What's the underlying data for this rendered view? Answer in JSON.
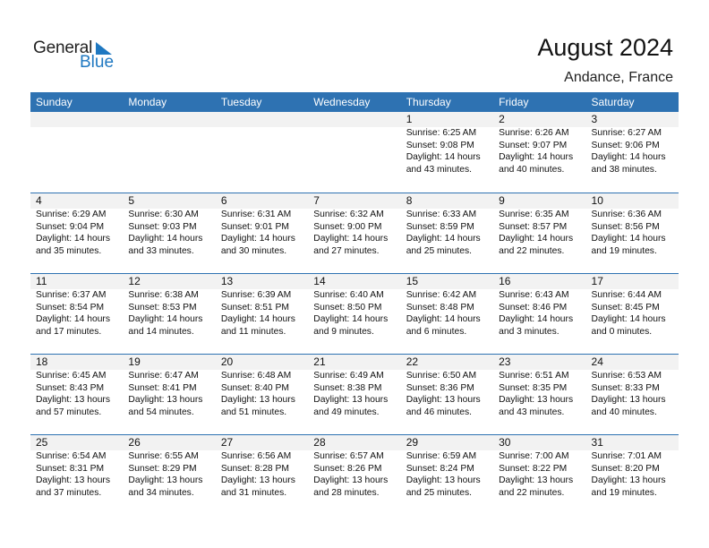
{
  "logo": {
    "line1": "General",
    "line2": "Blue"
  },
  "title": "August 2024",
  "location": "Andance, France",
  "colors": {
    "header_bg": "#2e72b2",
    "day_bar": "#f2f2f2",
    "logo_blue": "#1f78c1"
  },
  "weekdays": [
    "Sunday",
    "Monday",
    "Tuesday",
    "Wednesday",
    "Thursday",
    "Friday",
    "Saturday"
  ],
  "weeks": [
    [
      {
        "day": "",
        "sunrise": "",
        "sunset": "",
        "daylight": "",
        "minutes": ""
      },
      {
        "day": "",
        "sunrise": "",
        "sunset": "",
        "daylight": "",
        "minutes": ""
      },
      {
        "day": "",
        "sunrise": "",
        "sunset": "",
        "daylight": "",
        "minutes": ""
      },
      {
        "day": "",
        "sunrise": "",
        "sunset": "",
        "daylight": "",
        "minutes": ""
      },
      {
        "day": "1",
        "sunrise": "Sunrise: 6:25 AM",
        "sunset": "Sunset: 9:08 PM",
        "daylight": "Daylight: 14 hours",
        "minutes": "and 43 minutes."
      },
      {
        "day": "2",
        "sunrise": "Sunrise: 6:26 AM",
        "sunset": "Sunset: 9:07 PM",
        "daylight": "Daylight: 14 hours",
        "minutes": "and 40 minutes."
      },
      {
        "day": "3",
        "sunrise": "Sunrise: 6:27 AM",
        "sunset": "Sunset: 9:06 PM",
        "daylight": "Daylight: 14 hours",
        "minutes": "and 38 minutes."
      }
    ],
    [
      {
        "day": "4",
        "sunrise": "Sunrise: 6:29 AM",
        "sunset": "Sunset: 9:04 PM",
        "daylight": "Daylight: 14 hours",
        "minutes": "and 35 minutes."
      },
      {
        "day": "5",
        "sunrise": "Sunrise: 6:30 AM",
        "sunset": "Sunset: 9:03 PM",
        "daylight": "Daylight: 14 hours",
        "minutes": "and 33 minutes."
      },
      {
        "day": "6",
        "sunrise": "Sunrise: 6:31 AM",
        "sunset": "Sunset: 9:01 PM",
        "daylight": "Daylight: 14 hours",
        "minutes": "and 30 minutes."
      },
      {
        "day": "7",
        "sunrise": "Sunrise: 6:32 AM",
        "sunset": "Sunset: 9:00 PM",
        "daylight": "Daylight: 14 hours",
        "minutes": "and 27 minutes."
      },
      {
        "day": "8",
        "sunrise": "Sunrise: 6:33 AM",
        "sunset": "Sunset: 8:59 PM",
        "daylight": "Daylight: 14 hours",
        "minutes": "and 25 minutes."
      },
      {
        "day": "9",
        "sunrise": "Sunrise: 6:35 AM",
        "sunset": "Sunset: 8:57 PM",
        "daylight": "Daylight: 14 hours",
        "minutes": "and 22 minutes."
      },
      {
        "day": "10",
        "sunrise": "Sunrise: 6:36 AM",
        "sunset": "Sunset: 8:56 PM",
        "daylight": "Daylight: 14 hours",
        "minutes": "and 19 minutes."
      }
    ],
    [
      {
        "day": "11",
        "sunrise": "Sunrise: 6:37 AM",
        "sunset": "Sunset: 8:54 PM",
        "daylight": "Daylight: 14 hours",
        "minutes": "and 17 minutes."
      },
      {
        "day": "12",
        "sunrise": "Sunrise: 6:38 AM",
        "sunset": "Sunset: 8:53 PM",
        "daylight": "Daylight: 14 hours",
        "minutes": "and 14 minutes."
      },
      {
        "day": "13",
        "sunrise": "Sunrise: 6:39 AM",
        "sunset": "Sunset: 8:51 PM",
        "daylight": "Daylight: 14 hours",
        "minutes": "and 11 minutes."
      },
      {
        "day": "14",
        "sunrise": "Sunrise: 6:40 AM",
        "sunset": "Sunset: 8:50 PM",
        "daylight": "Daylight: 14 hours",
        "minutes": "and 9 minutes."
      },
      {
        "day": "15",
        "sunrise": "Sunrise: 6:42 AM",
        "sunset": "Sunset: 8:48 PM",
        "daylight": "Daylight: 14 hours",
        "minutes": "and 6 minutes."
      },
      {
        "day": "16",
        "sunrise": "Sunrise: 6:43 AM",
        "sunset": "Sunset: 8:46 PM",
        "daylight": "Daylight: 14 hours",
        "minutes": "and 3 minutes."
      },
      {
        "day": "17",
        "sunrise": "Sunrise: 6:44 AM",
        "sunset": "Sunset: 8:45 PM",
        "daylight": "Daylight: 14 hours",
        "minutes": "and 0 minutes."
      }
    ],
    [
      {
        "day": "18",
        "sunrise": "Sunrise: 6:45 AM",
        "sunset": "Sunset: 8:43 PM",
        "daylight": "Daylight: 13 hours",
        "minutes": "and 57 minutes."
      },
      {
        "day": "19",
        "sunrise": "Sunrise: 6:47 AM",
        "sunset": "Sunset: 8:41 PM",
        "daylight": "Daylight: 13 hours",
        "minutes": "and 54 minutes."
      },
      {
        "day": "20",
        "sunrise": "Sunrise: 6:48 AM",
        "sunset": "Sunset: 8:40 PM",
        "daylight": "Daylight: 13 hours",
        "minutes": "and 51 minutes."
      },
      {
        "day": "21",
        "sunrise": "Sunrise: 6:49 AM",
        "sunset": "Sunset: 8:38 PM",
        "daylight": "Daylight: 13 hours",
        "minutes": "and 49 minutes."
      },
      {
        "day": "22",
        "sunrise": "Sunrise: 6:50 AM",
        "sunset": "Sunset: 8:36 PM",
        "daylight": "Daylight: 13 hours",
        "minutes": "and 46 minutes."
      },
      {
        "day": "23",
        "sunrise": "Sunrise: 6:51 AM",
        "sunset": "Sunset: 8:35 PM",
        "daylight": "Daylight: 13 hours",
        "minutes": "and 43 minutes."
      },
      {
        "day": "24",
        "sunrise": "Sunrise: 6:53 AM",
        "sunset": "Sunset: 8:33 PM",
        "daylight": "Daylight: 13 hours",
        "minutes": "and 40 minutes."
      }
    ],
    [
      {
        "day": "25",
        "sunrise": "Sunrise: 6:54 AM",
        "sunset": "Sunset: 8:31 PM",
        "daylight": "Daylight: 13 hours",
        "minutes": "and 37 minutes."
      },
      {
        "day": "26",
        "sunrise": "Sunrise: 6:55 AM",
        "sunset": "Sunset: 8:29 PM",
        "daylight": "Daylight: 13 hours",
        "minutes": "and 34 minutes."
      },
      {
        "day": "27",
        "sunrise": "Sunrise: 6:56 AM",
        "sunset": "Sunset: 8:28 PM",
        "daylight": "Daylight: 13 hours",
        "minutes": "and 31 minutes."
      },
      {
        "day": "28",
        "sunrise": "Sunrise: 6:57 AM",
        "sunset": "Sunset: 8:26 PM",
        "daylight": "Daylight: 13 hours",
        "minutes": "and 28 minutes."
      },
      {
        "day": "29",
        "sunrise": "Sunrise: 6:59 AM",
        "sunset": "Sunset: 8:24 PM",
        "daylight": "Daylight: 13 hours",
        "minutes": "and 25 minutes."
      },
      {
        "day": "30",
        "sunrise": "Sunrise: 7:00 AM",
        "sunset": "Sunset: 8:22 PM",
        "daylight": "Daylight: 13 hours",
        "minutes": "and 22 minutes."
      },
      {
        "day": "31",
        "sunrise": "Sunrise: 7:01 AM",
        "sunset": "Sunset: 8:20 PM",
        "daylight": "Daylight: 13 hours",
        "minutes": "and 19 minutes."
      }
    ]
  ]
}
